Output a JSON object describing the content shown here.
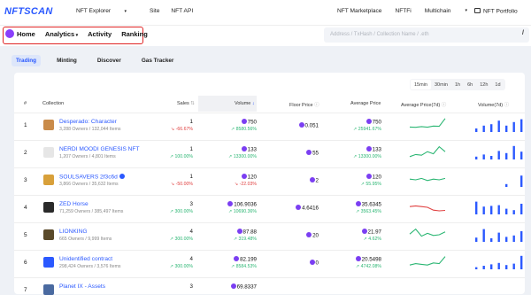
{
  "brand": {
    "logo": "NFTSCAN"
  },
  "topnav": {
    "explorer": "NFT Explorer",
    "site": "Site",
    "api": "NFT API"
  },
  "topright": {
    "marketplace": "NFT Marketplace",
    "nftfi": "NFTFi",
    "multichain": "Multichain",
    "portfolio": "NFT Portfolio"
  },
  "mainnav": {
    "home": "Home",
    "analytics": "Analytics",
    "activity": "Activity",
    "ranking": "Ranking"
  },
  "search": {
    "placeholder": "Address / TxHash / Collection Name / .eth",
    "shortcut": "/"
  },
  "tabs": [
    {
      "label": "Trading",
      "active": true
    },
    {
      "label": "Minting"
    },
    {
      "label": "Discover"
    },
    {
      "label": "Gas Tracker"
    }
  ],
  "time_ranges": [
    "15min",
    "30min",
    "1h",
    "6h",
    "12h",
    "1d"
  ],
  "time_selected": "15min",
  "headers": {
    "rank": "#",
    "collection": "Collection",
    "sales": "Sales",
    "volume": "Volume",
    "floor": "Floor Price",
    "avg": "Average Price",
    "avg7d": "Average Price(7d)",
    "vol7d": "Volume(7d)"
  },
  "rows": [
    {
      "rank": "1",
      "name": "Desperado: Character",
      "meta": "3,288 Owners / 132,044 Items",
      "sales": "1",
      "sales_chg": "-66.67%",
      "sales_up": false,
      "volume": "750",
      "volume_chg": "8580.56%",
      "volume_up": true,
      "floor": "0.051",
      "avg": "750",
      "avg_chg": "25941.67%",
      "avg_up": true,
      "avatar_color": "#c98b4a",
      "verified": false,
      "chart7d": [
        0.35,
        0.33,
        0.38,
        0.34,
        0.42,
        0.4,
        0.95
      ],
      "chart_color": "#2bb673",
      "bars7d": [
        0.25,
        0.45,
        0.55,
        0.8,
        0.45,
        0.7,
        0.9
      ]
    },
    {
      "rank": "2",
      "name": "NERDI MOODI GENESIS NFT",
      "meta": "1,207 Owners / 4,801 Items",
      "sales": "1",
      "sales_chg": "100.00%",
      "sales_up": true,
      "volume": "133",
      "volume_chg": "13300.00%",
      "volume_up": true,
      "floor": "55",
      "avg": "133",
      "avg_chg": "13300.00%",
      "avg_up": true,
      "avatar_color": "#e6e6e6",
      "verified": false,
      "chart7d": [
        0.2,
        0.35,
        0.3,
        0.55,
        0.4,
        0.9,
        0.55
      ],
      "chart_color": "#2bb673",
      "bars7d": [
        0.2,
        0.35,
        0.25,
        0.6,
        0.45,
        0.95,
        0.55
      ]
    },
    {
      "rank": "3",
      "name": "SOULSAVERS 2f3c6d",
      "meta": "3,866 Owners / 35,632 Items",
      "sales": "1",
      "sales_chg": "-50.00%",
      "sales_up": false,
      "volume": "120",
      "volume_chg": "-22.03%",
      "volume_up": false,
      "floor": "2",
      "avg": "120",
      "avg_chg": "55.95%",
      "avg_up": true,
      "avatar_color": "#d8a03a",
      "verified": true,
      "chart7d": [
        0.55,
        0.5,
        0.6,
        0.45,
        0.55,
        0.5,
        0.6
      ],
      "chart_color": "#2bb673",
      "bars7d": [
        0,
        0,
        0,
        0,
        0.2,
        0,
        0.8
      ]
    },
    {
      "rank": "4",
      "name": "ZED Horse",
      "meta": "71,259 Owners / 385,497 Items",
      "sales": "3",
      "sales_chg": "300.00%",
      "sales_up": true,
      "volume": "106.9036",
      "volume_chg": "10690.36%",
      "volume_up": true,
      "floor": "4.6416",
      "avg": "35.6345",
      "avg_chg": "3563.45%",
      "avg_up": true,
      "avatar_color": "#2a2a2a",
      "verified": false,
      "chart7d": [
        0.55,
        0.6,
        0.55,
        0.5,
        0.3,
        0.25,
        0.28
      ],
      "chart_color": "#e04040",
      "bars7d": [
        0.9,
        0.55,
        0.6,
        0.65,
        0.4,
        0.3,
        0.75
      ]
    },
    {
      "rank": "5",
      "name": "LIONKING",
      "meta": "665 Owners / 9,999 Items",
      "sales": "4",
      "sales_chg": "300.00%",
      "sales_up": true,
      "volume": "87.88",
      "volume_chg": "319.48%",
      "volume_up": true,
      "floor": "20",
      "avg": "21.97",
      "avg_chg": "4.62%",
      "avg_up": true,
      "avatar_color": "#5a4a2a",
      "verified": false,
      "chart7d": [
        0.55,
        0.9,
        0.4,
        0.6,
        0.45,
        0.5,
        0.7
      ],
      "chart_color": "#2bb673",
      "bars7d": [
        0.3,
        0.9,
        0.25,
        0.65,
        0.35,
        0.45,
        0.75
      ]
    },
    {
      "rank": "6",
      "name": "Unidentified contract",
      "meta": "298,424 Owners / 3,576 Items",
      "sales": "4",
      "sales_chg": "300.00%",
      "sales_up": true,
      "volume": "82.199",
      "volume_chg": "8584.53%",
      "volume_up": true,
      "floor": "0",
      "avg": "20.5498",
      "avg_chg": "4742.08%",
      "avg_up": true,
      "avatar_color": "#2b59ff",
      "verified": false,
      "chart7d": [
        0.3,
        0.4,
        0.35,
        0.3,
        0.45,
        0.4,
        0.9
      ],
      "chart_color": "#2bb673",
      "bars7d": [
        0.15,
        0.25,
        0.35,
        0.45,
        0.3,
        0.4,
        0.95
      ]
    },
    {
      "rank": "7",
      "name": "Planet IX - Assets",
      "meta": "",
      "sales": "3",
      "sales_chg": "",
      "sales_up": true,
      "volume": "69.8337",
      "volume_chg": "",
      "volume_up": true,
      "floor": "",
      "avg": "",
      "avg_chg": "",
      "avg_up": true,
      "avatar_color": "#4a6aa0",
      "verified": false,
      "chart7d": [],
      "chart_color": "#2bb673",
      "bars7d": []
    }
  ]
}
